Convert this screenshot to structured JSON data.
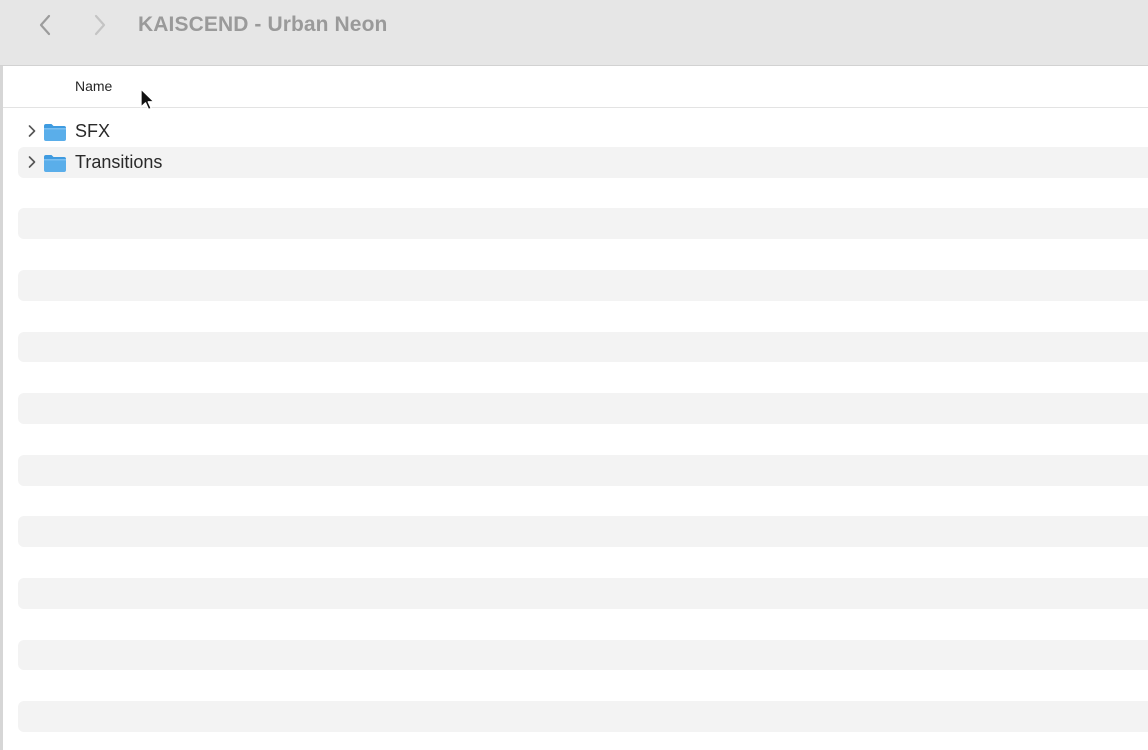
{
  "window": {
    "title": "KAISCEND - Urban Neon"
  },
  "toolbar": {
    "back_icon": "chevron-left-icon",
    "forward_icon": "chevron-right-icon"
  },
  "columns": {
    "name": "Name"
  },
  "items": [
    {
      "label": "SFX",
      "icon": "folder-icon",
      "expand_icon": "chevron-right-icon"
    },
    {
      "label": "Transitions",
      "icon": "folder-icon",
      "expand_icon": "chevron-right-icon"
    }
  ],
  "colors": {
    "toolbar_bg": "#e6e6e6",
    "stripe": "#f3f3f3",
    "folder_blue": "#5aaeea",
    "title_text": "#9a9a9a"
  }
}
